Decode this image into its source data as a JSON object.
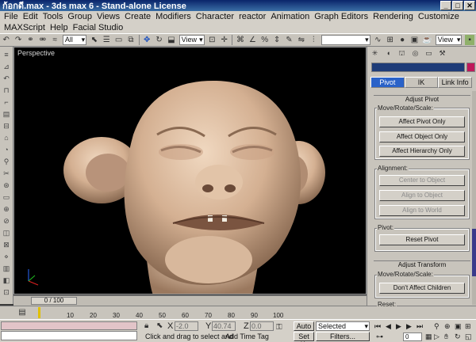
{
  "title": {
    "text": "ก้อกดี.max - 3ds max 6 - Stand-alone License",
    "buttons": [
      "_",
      "□",
      "✕"
    ]
  },
  "menu": {
    "row1": [
      "File",
      "Edit",
      "Tools",
      "Group",
      "Views",
      "Create",
      "Modifiers",
      "Character",
      "reactor",
      "Animation",
      "Graph Editors",
      "Rendering",
      "Customize"
    ],
    "row2": [
      "MAXScript",
      "Help",
      "Facial Studio"
    ]
  },
  "toolbar": {
    "filter_value": "All",
    "refcoord_value": "View",
    "selset_value": "",
    "view_value": "View"
  },
  "viewport": {
    "label": "Perspective"
  },
  "timeslider": {
    "value": "0 / 100"
  },
  "trackbar": {
    "ticks": [
      "10",
      "20",
      "30",
      "40",
      "50",
      "60",
      "70",
      "80",
      "90",
      "100"
    ]
  },
  "status": {
    "x_label": "X",
    "y_label": "Y",
    "z_label": "Z",
    "x_value": "-2.0",
    "y_value": "40.74",
    "z_value": "0.0",
    "prompt": "Click and drag to select and",
    "add_time_tag": "Add Time Tag",
    "auto_key": "Auto",
    "set_key": "Set K.",
    "key_filter_value": "Selected",
    "filters": "Filters...",
    "frame": "0"
  },
  "command_panel": {
    "subtabs": [
      "Pivot",
      "IK",
      "Link Info"
    ],
    "adjust_pivot": {
      "title": "Adjust Pivot",
      "move_group_label": "Move/Rotate/Scale:",
      "buttons": [
        "Affect Pivot Only",
        "Affect Object Only",
        "Affect Hierarchy Only"
      ],
      "alignment_label": "Alignment:",
      "align_buttons": [
        "Center to Object",
        "Align to Object",
        "Align to World"
      ],
      "pivot_label": "Pivot:",
      "reset_pivot": "Reset Pivot"
    },
    "adjust_transform": {
      "title": "Adjust Transform",
      "move_group_label": "Move/Rotate/Scale:",
      "dont_affect": "Don't Affect Children",
      "reset_label": "Reset:"
    }
  },
  "colors": {
    "title_bar": "#0a246a",
    "viewport_bg": "#000000",
    "skin": "#d8b89c",
    "active_tab": "#2a62c8",
    "object_color": "#c0185a"
  }
}
